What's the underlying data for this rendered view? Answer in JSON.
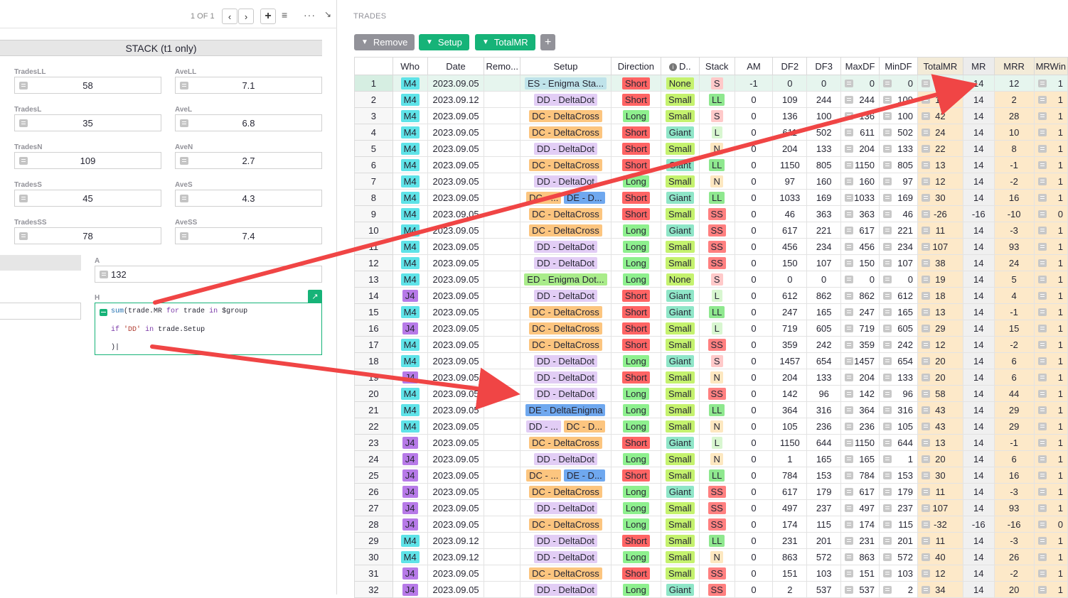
{
  "left": {
    "pager": "1 OF 1",
    "stack_title": "STACK  (t1 only)",
    "fields": [
      {
        "label": "TradesLL",
        "value": "58"
      },
      {
        "label": "AveLL",
        "value": "7.1"
      },
      {
        "label": "TradesL",
        "value": "35"
      },
      {
        "label": "AveL",
        "value": "6.8"
      },
      {
        "label": "TradesN",
        "value": "109"
      },
      {
        "label": "AveN",
        "value": "2.7"
      },
      {
        "label": "TradesS",
        "value": "45"
      },
      {
        "label": "AveS",
        "value": "4.3"
      },
      {
        "label": "TradesSS",
        "value": "78"
      },
      {
        "label": "AveSS",
        "value": "7.4"
      }
    ],
    "a_label": "A",
    "a_value": "132",
    "h_label": "H",
    "formula": {
      "line1_fn": "sum",
      "line1_rest": "(trade.MR ",
      "kw_for": "for",
      "mid1": " trade ",
      "kw_in": "in",
      "mid2": " $group",
      "kw_if": "if",
      "str_dd": "'DD'",
      "kw_in2": "in",
      "line2_rest": " trade.Setup",
      "line3": ")"
    }
  },
  "right": {
    "title": "TRADES",
    "buttons": {
      "remove": "Remove",
      "setup": "Setup",
      "totalmr": "TotalMR",
      "add": "+"
    },
    "headers": [
      "",
      "Who",
      "Date",
      "Remo...",
      "Setup",
      "Direction",
      "D..",
      "Stack",
      "AM",
      "DF2",
      "DF3",
      "MaxDF",
      "MinDF",
      "TotalMR",
      "MR",
      "MRR",
      "MRWin"
    ],
    "rows": [
      {
        "n": "1",
        "who": "M4",
        "date": "2023.09.05",
        "setup": [
          [
            "ES - Enigma Sta...",
            "es"
          ]
        ],
        "dir": "Short",
        "d": "None",
        "stack": "S",
        "am": "-1",
        "df2": "0",
        "df3": "0",
        "max": "0",
        "min": "0",
        "tmr": "26",
        "mr": "14",
        "mrr": "12",
        "win": "1"
      },
      {
        "n": "2",
        "who": "M4",
        "date": "2023.09.12",
        "setup": [
          [
            "DD - DeltaDot",
            "dd"
          ]
        ],
        "dir": "Short",
        "d": "Small",
        "stack": "LL",
        "am": "0",
        "df2": "109",
        "df3": "244",
        "max": "244",
        "min": "109",
        "tmr": "16",
        "mr": "14",
        "mrr": "2",
        "win": "1"
      },
      {
        "n": "3",
        "who": "M4",
        "date": "2023.09.05",
        "setup": [
          [
            "DC - DeltaCross",
            "dc"
          ]
        ],
        "dir": "Long",
        "d": "Small",
        "stack": "S",
        "am": "0",
        "df2": "136",
        "df3": "100",
        "max": "136",
        "min": "100",
        "tmr": "42",
        "mr": "14",
        "mrr": "28",
        "win": "1"
      },
      {
        "n": "4",
        "who": "M4",
        "date": "2023.09.05",
        "setup": [
          [
            "DC - DeltaCross",
            "dc"
          ]
        ],
        "dir": "Short",
        "d": "Giant",
        "stack": "L",
        "am": "0",
        "df2": "611",
        "df3": "502",
        "max": "611",
        "min": "502",
        "tmr": "24",
        "mr": "14",
        "mrr": "10",
        "win": "1"
      },
      {
        "n": "5",
        "who": "M4",
        "date": "2023.09.05",
        "setup": [
          [
            "DD - DeltaDot",
            "dd"
          ]
        ],
        "dir": "Short",
        "d": "Small",
        "stack": "N",
        "am": "0",
        "df2": "204",
        "df3": "133",
        "max": "204",
        "min": "133",
        "tmr": "22",
        "mr": "14",
        "mrr": "8",
        "win": "1"
      },
      {
        "n": "6",
        "who": "M4",
        "date": "2023.09.05",
        "setup": [
          [
            "DC - DeltaCross",
            "dc"
          ]
        ],
        "dir": "Short",
        "d": "Giant",
        "stack": "LL",
        "am": "0",
        "df2": "1150",
        "df3": "805",
        "max": "1150",
        "min": "805",
        "tmr": "13",
        "mr": "14",
        "mrr": "-1",
        "win": "1"
      },
      {
        "n": "7",
        "who": "M4",
        "date": "2023.09.05",
        "setup": [
          [
            "DD - DeltaDot",
            "dd"
          ]
        ],
        "dir": "Long",
        "d": "Small",
        "stack": "N",
        "am": "0",
        "df2": "97",
        "df3": "160",
        "max": "160",
        "min": "97",
        "tmr": "12",
        "mr": "14",
        "mrr": "-2",
        "win": "1"
      },
      {
        "n": "8",
        "who": "M4",
        "date": "2023.09.05",
        "setup": [
          [
            "DC - ...",
            "dc"
          ],
          [
            "DE - D...",
            "de"
          ]
        ],
        "dir": "Short",
        "d": "Giant",
        "stack": "LL",
        "am": "0",
        "df2": "1033",
        "df3": "169",
        "max": "1033",
        "min": "169",
        "tmr": "30",
        "mr": "14",
        "mrr": "16",
        "win": "1"
      },
      {
        "n": "9",
        "who": "M4",
        "date": "2023.09.05",
        "setup": [
          [
            "DC - DeltaCross",
            "dc"
          ]
        ],
        "dir": "Short",
        "d": "Small",
        "stack": "SS",
        "am": "0",
        "df2": "46",
        "df3": "363",
        "max": "363",
        "min": "46",
        "tmr": "-26",
        "mr": "-16",
        "mrr": "-10",
        "win": "0"
      },
      {
        "n": "10",
        "who": "M4",
        "date": "2023.09.05",
        "setup": [
          [
            "DC - DeltaCross",
            "dc"
          ]
        ],
        "dir": "Long",
        "d": "Giant",
        "stack": "SS",
        "am": "0",
        "df2": "617",
        "df3": "221",
        "max": "617",
        "min": "221",
        "tmr": "11",
        "mr": "14",
        "mrr": "-3",
        "win": "1"
      },
      {
        "n": "11",
        "who": "M4",
        "date": "2023.09.05",
        "setup": [
          [
            "DD - DeltaDot",
            "dd"
          ]
        ],
        "dir": "Long",
        "d": "Small",
        "stack": "SS",
        "am": "0",
        "df2": "456",
        "df3": "234",
        "max": "456",
        "min": "234",
        "tmr": "107",
        "mr": "14",
        "mrr": "93",
        "win": "1"
      },
      {
        "n": "12",
        "who": "M4",
        "date": "2023.09.05",
        "setup": [
          [
            "DD - DeltaDot",
            "dd"
          ]
        ],
        "dir": "Long",
        "d": "Small",
        "stack": "SS",
        "am": "0",
        "df2": "150",
        "df3": "107",
        "max": "150",
        "min": "107",
        "tmr": "38",
        "mr": "14",
        "mrr": "24",
        "win": "1"
      },
      {
        "n": "13",
        "who": "M4",
        "date": "2023.09.05",
        "setup": [
          [
            "ED - Enigma Dot...",
            "ed"
          ]
        ],
        "dir": "Long",
        "d": "None",
        "stack": "S",
        "am": "0",
        "df2": "0",
        "df3": "0",
        "max": "0",
        "min": "0",
        "tmr": "19",
        "mr": "14",
        "mrr": "5",
        "win": "1"
      },
      {
        "n": "14",
        "who": "J4",
        "date": "2023.09.05",
        "setup": [
          [
            "DD - DeltaDot",
            "dd"
          ]
        ],
        "dir": "Short",
        "d": "Giant",
        "stack": "L",
        "am": "0",
        "df2": "612",
        "df3": "862",
        "max": "862",
        "min": "612",
        "tmr": "18",
        "mr": "14",
        "mrr": "4",
        "win": "1"
      },
      {
        "n": "15",
        "who": "M4",
        "date": "2023.09.05",
        "setup": [
          [
            "DC - DeltaCross",
            "dc"
          ]
        ],
        "dir": "Short",
        "d": "Giant",
        "stack": "LL",
        "am": "0",
        "df2": "247",
        "df3": "165",
        "max": "247",
        "min": "165",
        "tmr": "13",
        "mr": "14",
        "mrr": "-1",
        "win": "1"
      },
      {
        "n": "16",
        "who": "J4",
        "date": "2023.09.05",
        "setup": [
          [
            "DC - DeltaCross",
            "dc"
          ]
        ],
        "dir": "Short",
        "d": "Small",
        "stack": "L",
        "am": "0",
        "df2": "719",
        "df3": "605",
        "max": "719",
        "min": "605",
        "tmr": "29",
        "mr": "14",
        "mrr": "15",
        "win": "1"
      },
      {
        "n": "17",
        "who": "M4",
        "date": "2023.09.05",
        "setup": [
          [
            "DC - DeltaCross",
            "dc"
          ]
        ],
        "dir": "Short",
        "d": "Small",
        "stack": "SS",
        "am": "0",
        "df2": "359",
        "df3": "242",
        "max": "359",
        "min": "242",
        "tmr": "12",
        "mr": "14",
        "mrr": "-2",
        "win": "1"
      },
      {
        "n": "18",
        "who": "M4",
        "date": "2023.09.05",
        "setup": [
          [
            "DD - DeltaDot",
            "dd"
          ]
        ],
        "dir": "Long",
        "d": "Giant",
        "stack": "S",
        "am": "0",
        "df2": "1457",
        "df3": "654",
        "max": "1457",
        "min": "654",
        "tmr": "20",
        "mr": "14",
        "mrr": "6",
        "win": "1"
      },
      {
        "n": "19",
        "who": "J4",
        "date": "2023.09.05",
        "setup": [
          [
            "DD - DeltaDot",
            "dd"
          ]
        ],
        "dir": "Short",
        "d": "Small",
        "stack": "N",
        "am": "0",
        "df2": "204",
        "df3": "133",
        "max": "204",
        "min": "133",
        "tmr": "20",
        "mr": "14",
        "mrr": "6",
        "win": "1"
      },
      {
        "n": "20",
        "who": "M4",
        "date": "2023.09.05",
        "setup": [
          [
            "DD - DeltaDot",
            "dd"
          ]
        ],
        "dir": "Long",
        "d": "Small",
        "stack": "SS",
        "am": "0",
        "df2": "142",
        "df3": "96",
        "max": "142",
        "min": "96",
        "tmr": "58",
        "mr": "14",
        "mrr": "44",
        "win": "1"
      },
      {
        "n": "21",
        "who": "M4",
        "date": "2023.09.05",
        "setup": [
          [
            "DE - DeltaEnigma",
            "de"
          ]
        ],
        "dir": "Long",
        "d": "Small",
        "stack": "LL",
        "am": "0",
        "df2": "364",
        "df3": "316",
        "max": "364",
        "min": "316",
        "tmr": "43",
        "mr": "14",
        "mrr": "29",
        "win": "1"
      },
      {
        "n": "22",
        "who": "M4",
        "date": "2023.09.05",
        "setup": [
          [
            "DD - ...",
            "dd"
          ],
          [
            "DC - D...",
            "dc"
          ]
        ],
        "dir": "Long",
        "d": "Small",
        "stack": "N",
        "am": "0",
        "df2": "105",
        "df3": "236",
        "max": "236",
        "min": "105",
        "tmr": "43",
        "mr": "14",
        "mrr": "29",
        "win": "1"
      },
      {
        "n": "23",
        "who": "J4",
        "date": "2023.09.05",
        "setup": [
          [
            "DC - DeltaCross",
            "dc"
          ]
        ],
        "dir": "Short",
        "d": "Giant",
        "stack": "L",
        "am": "0",
        "df2": "1150",
        "df3": "644",
        "max": "1150",
        "min": "644",
        "tmr": "13",
        "mr": "14",
        "mrr": "-1",
        "win": "1"
      },
      {
        "n": "24",
        "who": "J4",
        "date": "2023.09.05",
        "setup": [
          [
            "DD - DeltaDot",
            "dd"
          ]
        ],
        "dir": "Long",
        "d": "Small",
        "stack": "N",
        "am": "0",
        "df2": "1",
        "df3": "165",
        "max": "165",
        "min": "1",
        "tmr": "20",
        "mr": "14",
        "mrr": "6",
        "win": "1"
      },
      {
        "n": "25",
        "who": "J4",
        "date": "2023.09.05",
        "setup": [
          [
            "DC - ...",
            "dc"
          ],
          [
            "DE - D...",
            "de"
          ]
        ],
        "dir": "Short",
        "d": "Small",
        "stack": "LL",
        "am": "0",
        "df2": "784",
        "df3": "153",
        "max": "784",
        "min": "153",
        "tmr": "30",
        "mr": "14",
        "mrr": "16",
        "win": "1"
      },
      {
        "n": "26",
        "who": "J4",
        "date": "2023.09.05",
        "setup": [
          [
            "DC - DeltaCross",
            "dc"
          ]
        ],
        "dir": "Long",
        "d": "Giant",
        "stack": "SS",
        "am": "0",
        "df2": "617",
        "df3": "179",
        "max": "617",
        "min": "179",
        "tmr": "11",
        "mr": "14",
        "mrr": "-3",
        "win": "1"
      },
      {
        "n": "27",
        "who": "J4",
        "date": "2023.09.05",
        "setup": [
          [
            "DD - DeltaDot",
            "dd"
          ]
        ],
        "dir": "Long",
        "d": "Small",
        "stack": "SS",
        "am": "0",
        "df2": "497",
        "df3": "237",
        "max": "497",
        "min": "237",
        "tmr": "107",
        "mr": "14",
        "mrr": "93",
        "win": "1"
      },
      {
        "n": "28",
        "who": "J4",
        "date": "2023.09.05",
        "setup": [
          [
            "DC - DeltaCross",
            "dc"
          ]
        ],
        "dir": "Long",
        "d": "Small",
        "stack": "SS",
        "am": "0",
        "df2": "174",
        "df3": "115",
        "max": "174",
        "min": "115",
        "tmr": "-32",
        "mr": "-16",
        "mrr": "-16",
        "win": "0"
      },
      {
        "n": "29",
        "who": "M4",
        "date": "2023.09.12",
        "setup": [
          [
            "DD - DeltaDot",
            "dd"
          ]
        ],
        "dir": "Short",
        "d": "Small",
        "stack": "LL",
        "am": "0",
        "df2": "231",
        "df3": "201",
        "max": "231",
        "min": "201",
        "tmr": "11",
        "mr": "14",
        "mrr": "-3",
        "win": "1"
      },
      {
        "n": "30",
        "who": "M4",
        "date": "2023.09.12",
        "setup": [
          [
            "DD - DeltaDot",
            "dd"
          ]
        ],
        "dir": "Long",
        "d": "Small",
        "stack": "N",
        "am": "0",
        "df2": "863",
        "df3": "572",
        "max": "863",
        "min": "572",
        "tmr": "40",
        "mr": "14",
        "mrr": "26",
        "win": "1"
      },
      {
        "n": "31",
        "who": "J4",
        "date": "2023.09.05",
        "setup": [
          [
            "DC - DeltaCross",
            "dc"
          ]
        ],
        "dir": "Short",
        "d": "Small",
        "stack": "SS",
        "am": "0",
        "df2": "151",
        "df3": "103",
        "max": "151",
        "min": "103",
        "tmr": "12",
        "mr": "14",
        "mrr": "-2",
        "win": "1"
      },
      {
        "n": "32",
        "who": "J4",
        "date": "2023.09.05",
        "setup": [
          [
            "DD - DeltaDot",
            "dd"
          ]
        ],
        "dir": "Long",
        "d": "Giant",
        "stack": "SS",
        "am": "0",
        "df2": "2",
        "df3": "537",
        "max": "537",
        "min": "2",
        "tmr": "34",
        "mr": "14",
        "mrr": "20",
        "win": "1"
      }
    ]
  },
  "colors": {
    "green": "#16b378",
    "grey_btn": "#929299",
    "who_M4": "#5fe3e8",
    "who_J4": "#b77ae8",
    "setup_dd": "#e2cdf5",
    "setup_dc": "#fcc57f",
    "setup_de": "#6fa8ef",
    "setup_es": "#bfe3ea",
    "setup_ed": "#a9ec8a",
    "dir_Short": "#ff6464",
    "dir_Long": "#8ef08e",
    "d_Small": "#c5f26e",
    "d_Giant": "#8fe6c8",
    "d_None": "#c5f26e",
    "stack_SS": "#ff8080",
    "stack_S": "#ffc9c9",
    "stack_N": "#fde7c0",
    "stack_L": "#d8f6d0",
    "stack_LL": "#8fe88f",
    "arrow": "#f04545"
  }
}
